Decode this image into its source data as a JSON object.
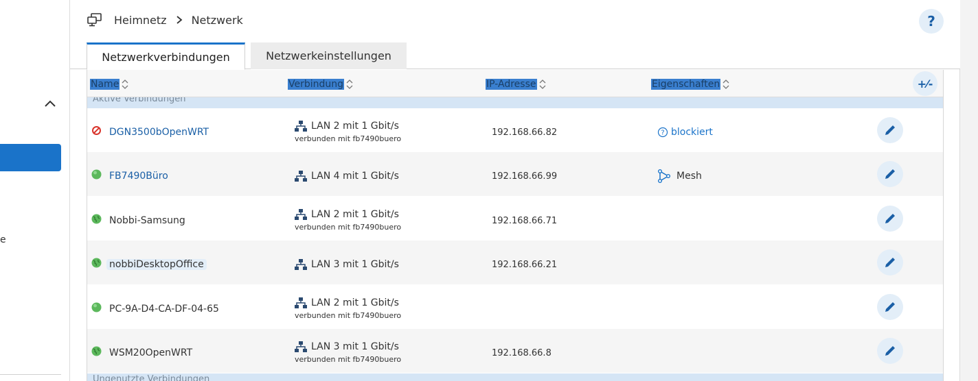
{
  "breadcrumb": {
    "home": "Heimnetz",
    "current": "Netzwerk"
  },
  "help_label": "?",
  "tabs": [
    {
      "label": "Netzwerkverbindungen",
      "active": true
    },
    {
      "label": "Netzwerkeinstellungen",
      "active": false
    }
  ],
  "sidebar": {
    "cut_text": "e"
  },
  "table": {
    "columns": {
      "name": "Name",
      "connection": "Verbindung",
      "ip": "IP-Adresse",
      "properties": "Eigenschaften"
    },
    "plusminus": "+⁄-",
    "group_active": "Aktive Verbindungen",
    "group_bottom": "Ungenutzte Verbindungen",
    "rows": [
      {
        "name": "DGN3500bOpenWRT",
        "status": "blocked",
        "conn": "LAN 2 mit 1 Gbit/s",
        "via": "verbunden mit fb7490buero",
        "ip": "192.168.66.82",
        "prop": "blockiert"
      },
      {
        "name": "FB7490Büro",
        "status": "green",
        "conn": "LAN 4 mit 1 Gbit/s",
        "via": "",
        "ip": "192.168.66.99",
        "prop": "Mesh"
      },
      {
        "name": "Nobbi-Samsung",
        "status": "globe",
        "conn": "LAN 2 mit 1 Gbit/s",
        "via": "verbunden mit fb7490buero",
        "ip": "192.168.66.71",
        "prop": ""
      },
      {
        "name": "nobbiDesktopOffice",
        "status": "globe",
        "conn": "LAN 3 mit 1 Gbit/s",
        "via": "",
        "ip": "192.168.66.21",
        "prop": ""
      },
      {
        "name": "PC-9A-D4-CA-DF-04-65",
        "status": "green",
        "conn": "LAN 2 mit 1 Gbit/s",
        "via": "verbunden mit fb7490buero",
        "ip": "",
        "prop": ""
      },
      {
        "name": "WSM20OpenWRT",
        "status": "globe",
        "conn": "LAN 3 mit 1 Gbit/s",
        "via": "verbunden mit fb7490buero",
        "ip": "192.168.66.8",
        "prop": ""
      }
    ]
  },
  "colors": {
    "accent": "#1a73c9",
    "link": "#1a5fa6",
    "status_green": "#5cb85c",
    "status_blocked": "#d9342b"
  }
}
